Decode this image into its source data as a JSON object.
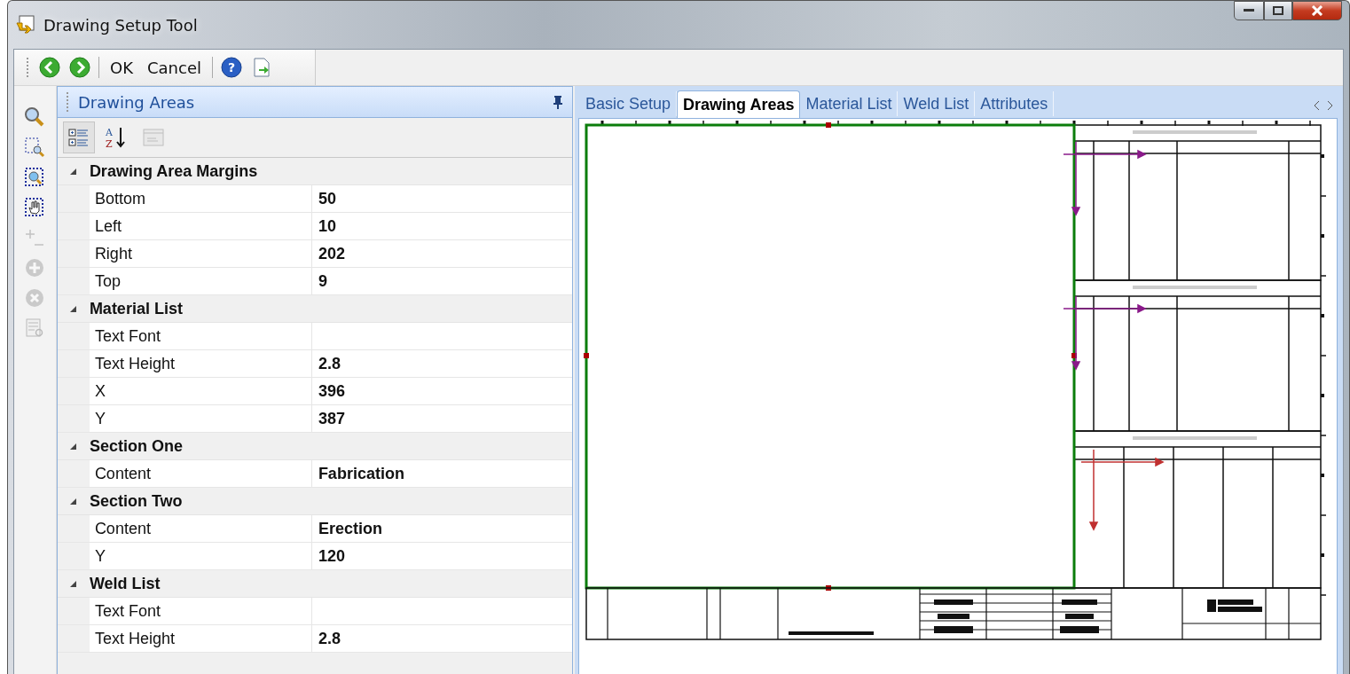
{
  "window": {
    "title": "Drawing Setup Tool"
  },
  "toolbar": [
    {
      "kind": "back"
    },
    {
      "kind": "forward"
    },
    {
      "kind": "separator"
    },
    {
      "kind": "text",
      "label": "OK"
    },
    {
      "kind": "text",
      "label": "Cancel"
    },
    {
      "kind": "separator"
    },
    {
      "kind": "help",
      "glyph": "?"
    },
    {
      "kind": "export"
    }
  ],
  "side_tools": [
    {
      "kind": "zoom",
      "disabled": false
    },
    {
      "kind": "zoom-area",
      "disabled": false
    },
    {
      "kind": "zoom-fit",
      "disabled": false
    },
    {
      "kind": "pan",
      "disabled": false
    },
    {
      "kind": "plus-minus",
      "disabled": true
    },
    {
      "kind": "add",
      "disabled": true
    },
    {
      "kind": "remove",
      "disabled": true
    },
    {
      "kind": "table-search",
      "disabled": true
    }
  ],
  "panel": {
    "title": "Drawing Areas",
    "grid_toolbar": [
      {
        "kind": "categorized",
        "selected": true,
        "disabled": false
      },
      {
        "kind": "alphabetical",
        "selected": false,
        "disabled": false,
        "letters": [
          "A",
          "Z"
        ]
      },
      {
        "kind": "pages",
        "selected": false,
        "disabled": true
      }
    ],
    "categories": [
      {
        "name": "Drawing Area Margins",
        "expanded": true,
        "properties": [
          {
            "name": "Bottom",
            "value": "50"
          },
          {
            "name": "Left",
            "value": "10"
          },
          {
            "name": "Right",
            "value": "202"
          },
          {
            "name": "Top",
            "value": "9"
          }
        ]
      },
      {
        "name": "Material List",
        "expanded": true,
        "properties": [
          {
            "name": "Text Font"
          },
          {
            "name": "Text Height",
            "value": "2.8"
          },
          {
            "name": "X",
            "value": "396"
          },
          {
            "name": "Y",
            "value": "387"
          }
        ]
      },
      {
        "name": "Section One",
        "expanded": true,
        "properties": [
          {
            "name": "Content",
            "value": "Fabrication"
          }
        ]
      },
      {
        "name": "Section Two",
        "expanded": true,
        "properties": [
          {
            "name": "Content",
            "value": "Erection"
          },
          {
            "name": "Y",
            "value": "120"
          }
        ]
      },
      {
        "name": "Weld List",
        "expanded": true,
        "properties": [
          {
            "name": "Text Font"
          },
          {
            "name": "Text Height",
            "value": "2.8"
          }
        ]
      }
    ]
  },
  "tabs": [
    {
      "label": "Basic Setup",
      "selected": false
    },
    {
      "label": "Drawing Areas",
      "selected": true
    },
    {
      "label": "Material List",
      "selected": false
    },
    {
      "label": "Weld List",
      "selected": false
    },
    {
      "label": "Attributes",
      "selected": false
    }
  ]
}
